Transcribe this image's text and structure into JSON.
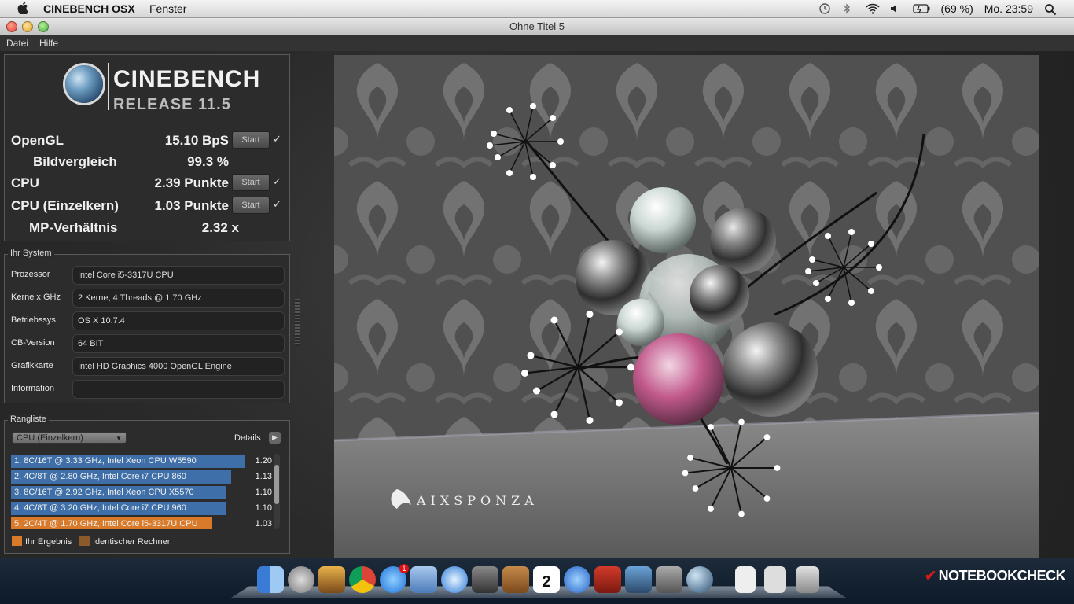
{
  "menubar": {
    "apple": "",
    "app_name": "CINEBENCH OSX",
    "menu_window": "Fenster",
    "battery_pct": "(69 %)",
    "clock": "Mo. 23:59",
    "icons": [
      "time-machine-icon",
      "bluetooth-icon",
      "wifi-icon",
      "volume-icon",
      "battery-icon",
      "spotlight-icon"
    ]
  },
  "window": {
    "title": "Ohne Titel 5",
    "menu": [
      "Datei",
      "Hilfe"
    ]
  },
  "logo": {
    "brand": "CINEBENCH",
    "release": "RELEASE 11.5"
  },
  "scores": {
    "opengl_label": "OpenGL",
    "opengl_value": "15.10 BpS",
    "bildvergleich_label": "Bildvergleich",
    "bildvergleich_value": "99.3 %",
    "cpu_label": "CPU",
    "cpu_value": "2.39 Punkte",
    "cpu_single_label": "CPU (Einzelkern)",
    "cpu_single_value": "1.03 Punkte",
    "mp_label": "MP-Verhältnis",
    "mp_value": "2.32 x",
    "start_label": "Start",
    "check": "✓"
  },
  "system": {
    "legend": "Ihr System",
    "rows": [
      {
        "label": "Prozessor",
        "value": "Intel Core i5-3317U CPU"
      },
      {
        "label": "Kerne x GHz",
        "value": "2 Kerne, 4 Threads @ 1.70 GHz"
      },
      {
        "label": "Betriebssys.",
        "value": "OS X 10.7.4"
      },
      {
        "label": "CB-Version",
        "value": "64 BIT"
      },
      {
        "label": "Grafikkarte",
        "value": "Intel HD Graphics 4000 OpenGL Engine"
      },
      {
        "label": "Information",
        "value": ""
      }
    ]
  },
  "ranking": {
    "legend": "Rangliste",
    "dropdown": "CPU (Einzelkern)",
    "details": "Details",
    "items": [
      {
        "text": "1. 8C/16T @ 3.33 GHz, Intel Xeon CPU W5590",
        "score": "1.20",
        "fill": 1.0,
        "color": "#3f6fa8"
      },
      {
        "text": "2. 4C/8T @ 2.80 GHz, Intel Core i7 CPU 860",
        "score": "1.13",
        "fill": 0.94,
        "color": "#3f6fa8"
      },
      {
        "text": "3. 8C/16T @ 2.92 GHz, Intel Xeon CPU X5570",
        "score": "1.10",
        "fill": 0.92,
        "color": "#3f6fa8"
      },
      {
        "text": "4. 4C/8T @ 3.20 GHz, Intel Core i7 CPU 960",
        "score": "1.10",
        "fill": 0.92,
        "color": "#3f6fa8"
      },
      {
        "text": "5. 2C/4T @ 1.70 GHz, Intel Core i5-3317U CPU",
        "score": "1.03",
        "fill": 0.86,
        "color": "#d97a2a"
      }
    ],
    "legend_own": "Ihr Ergebnis",
    "legend_own_color": "#d97a2a",
    "legend_identical": "Identischer Rechner",
    "legend_identical_color": "#8a5a2a"
  },
  "render": {
    "watermark": "AIXSPONZA"
  },
  "dock": {
    "icons": [
      "finder-icon",
      "launchpad-icon",
      "app-icon",
      "chrome-icon",
      "app-store-icon",
      "mail-icon",
      "safari-icon",
      "facetime-icon",
      "address-book-icon",
      "calendar-icon",
      "itunes-icon",
      "photo-booth-icon",
      "iphoto-icon",
      "system-preferences-icon",
      "cinebench-icon",
      "document-icon",
      "preview-icon",
      "trash-icon"
    ],
    "calendar_day": "2",
    "badge": "1"
  },
  "overlay_brand": "NOTEBOOKCHECK"
}
